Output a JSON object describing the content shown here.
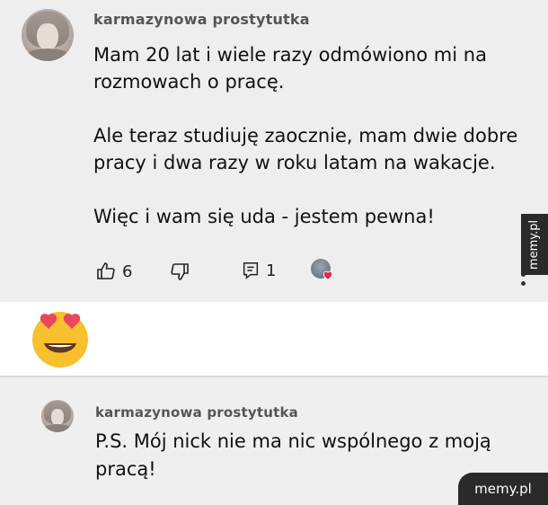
{
  "comment": {
    "username": "karmazynowa prostytutka",
    "text": "Mam 20 lat i wiele razy odmówiono mi na\nrozmowach o pracę.\n\nAle teraz studiuję zaocznie, mam dwie dobre\npracy i dwa razy w roku latam na wakacje.\n\nWięc i wam się uda - jestem pewna!",
    "likes": "6",
    "replies": "1",
    "icons": [
      "thumbs-up-icon",
      "thumbs-down-icon",
      "reply-icon",
      "creator-heart-icon",
      "more-vert-icon"
    ]
  },
  "reaction_emoji": "heart-eyes-emoji",
  "reply": {
    "username": "karmazynowa prostytutka",
    "text": "P.S. Mój nick nie ma nic wspólnego z moją\npracą!"
  },
  "watermarks": {
    "side": "memy.pl",
    "corner": "memy.pl"
  },
  "colors": {
    "panel_bg": "#eeeeee",
    "heart": "#e0245e",
    "emoji_face": "#f7c02c",
    "watermark_bg": "#2a2a2a"
  }
}
